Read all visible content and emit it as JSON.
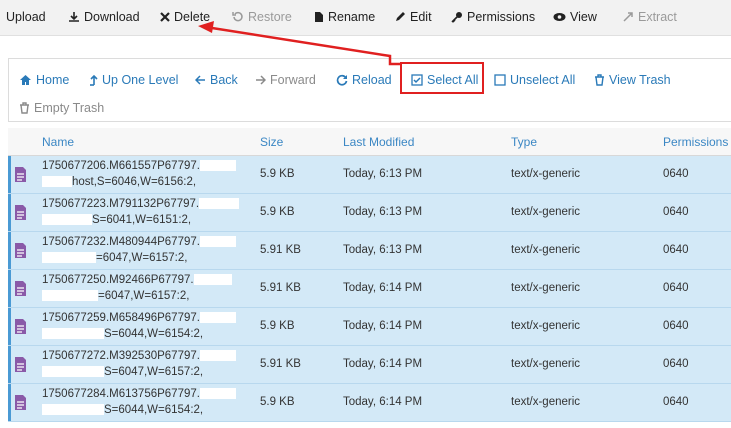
{
  "toolbar": {
    "upload": "Upload",
    "download": "Download",
    "delete": "Delete",
    "restore": "Restore",
    "rename": "Rename",
    "edit": "Edit",
    "permissions": "Permissions",
    "view": "View",
    "extract": "Extract"
  },
  "nav": {
    "home": "Home",
    "up_one_level": "Up One Level",
    "back": "Back",
    "forward": "Forward",
    "reload": "Reload",
    "select_all": "Select All",
    "unselect_all": "Unselect All",
    "view_trash": "View Trash",
    "empty_trash": "Empty Trash"
  },
  "table": {
    "headers": [
      "Name",
      "Size",
      "Last Modified",
      "Type",
      "Permissions"
    ],
    "rows": [
      {
        "name_line1": "1750677206.M661557P67797.",
        "name_line2": "host,S=6046,W=6156:2,",
        "size": "5.9 KB",
        "modified": "Today, 6:13 PM",
        "type": "text/x-generic",
        "perms": "0640"
      },
      {
        "name_line1": "1750677223.M791132P67797.",
        "name_line2": "S=6041,W=6151:2,",
        "size": "5.9 KB",
        "modified": "Today, 6:13 PM",
        "type": "text/x-generic",
        "perms": "0640"
      },
      {
        "name_line1": "1750677232.M480944P67797.",
        "name_line2": "=6047,W=6157:2,",
        "size": "5.91 KB",
        "modified": "Today, 6:13 PM",
        "type": "text/x-generic",
        "perms": "0640"
      },
      {
        "name_line1": "1750677250.M92466P67797.",
        "name_line2": "=6047,W=6157:2,",
        "size": "5.91 KB",
        "modified": "Today, 6:14 PM",
        "type": "text/x-generic",
        "perms": "0640"
      },
      {
        "name_line1": "1750677259.M658496P67797.",
        "name_line2": "S=6044,W=6154:2,",
        "size": "5.9 KB",
        "modified": "Today, 6:14 PM",
        "type": "text/x-generic",
        "perms": "0640"
      },
      {
        "name_line1": "1750677272.M392530P67797.",
        "name_line2": "S=6047,W=6157:2,",
        "size": "5.91 KB",
        "modified": "Today, 6:14 PM",
        "type": "text/x-generic",
        "perms": "0640"
      },
      {
        "name_line1": "1750677284.M613756P67797.",
        "name_line2": "S=6044,W=6154:2,",
        "size": "5.9 KB",
        "modified": "Today, 6:14 PM",
        "type": "text/x-generic",
        "perms": "0640"
      }
    ]
  },
  "colors": {
    "link": "#2a7ab8",
    "row_selected": "#d3e9f7",
    "annotation": "#e02020"
  }
}
